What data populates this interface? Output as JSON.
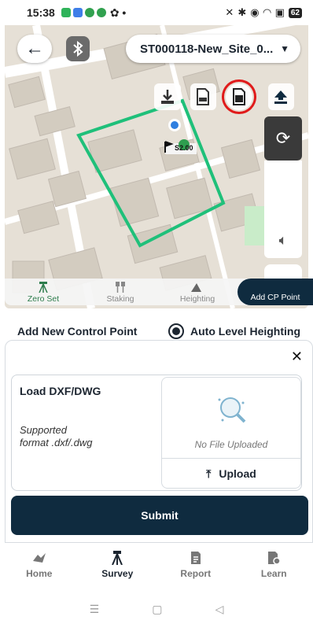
{
  "status_bar": {
    "time": "15:38",
    "battery": "62"
  },
  "header": {
    "site_name": "ST000118-New_Site_0...",
    "back_icon": "arrow-left-icon",
    "bluetooth_icon": "bluetooth-icon"
  },
  "map": {
    "toolbar_icons": [
      "stakeout-icon",
      "csv-file-icon",
      "dxf-file-icon",
      "upload-icon"
    ],
    "marker_label": "S2.00",
    "boundary_color": "#1fc07a",
    "highlight_color": "#e01b1b"
  },
  "mode_tabs": [
    {
      "label": "Zero Set",
      "icon": "tripod-icon"
    },
    {
      "label": "Staking",
      "icon": "stake-icon"
    },
    {
      "label": "Heighting",
      "icon": "mountain-icon"
    },
    {
      "label": "Add CP Point",
      "icon": ""
    }
  ],
  "control": {
    "label": "Add New Control Point",
    "radio_label": "Auto Level Heighting"
  },
  "upload": {
    "title": "Load DXF/DWG",
    "hint": "Supported\nformat .dxf/.dwg",
    "empty_text": "No File Uploaded",
    "button_label": "Upload"
  },
  "submit_label": "Submit",
  "bottom_nav": [
    {
      "label": "Home",
      "icon": "home-icon"
    },
    {
      "label": "Survey",
      "icon": "survey-icon"
    },
    {
      "label": "Report",
      "icon": "report-icon"
    },
    {
      "label": "Learn",
      "icon": "learn-icon"
    }
  ],
  "accent_color": "#0f2b3f"
}
